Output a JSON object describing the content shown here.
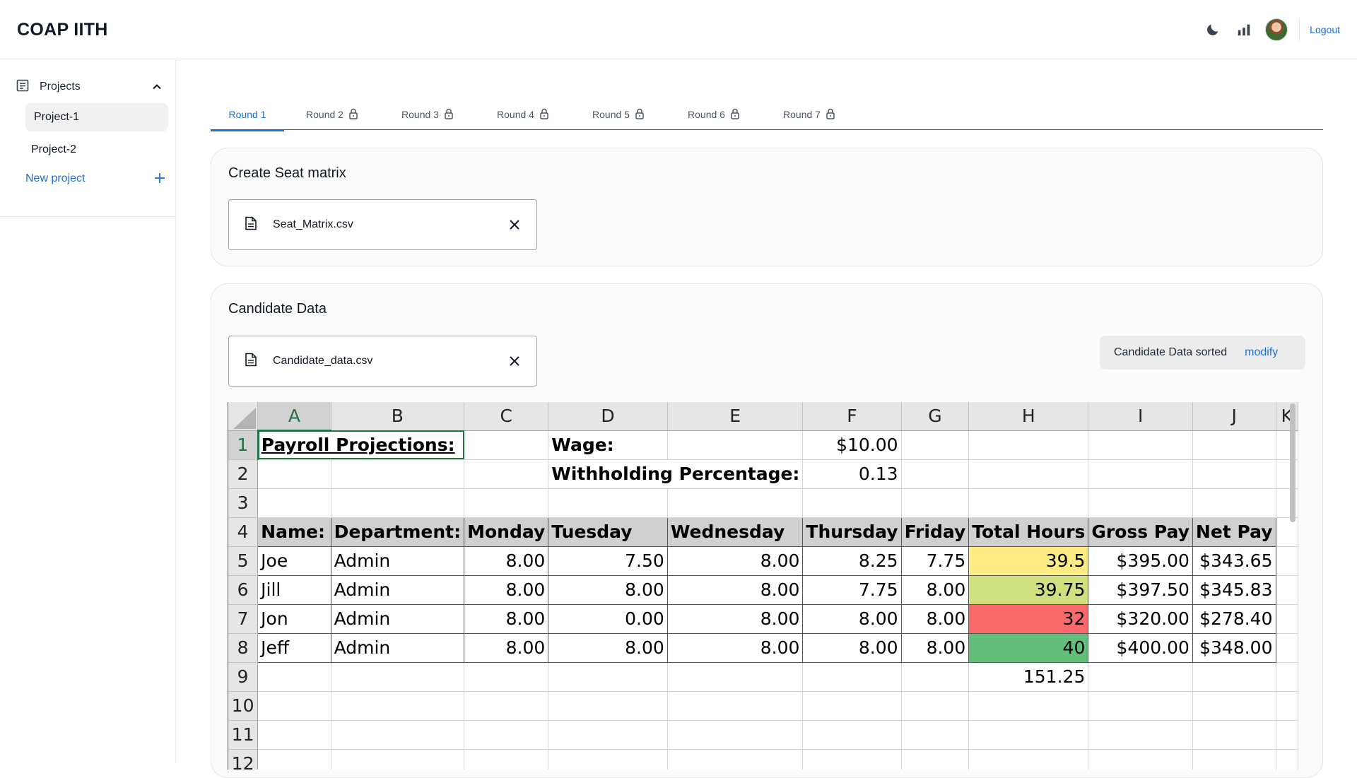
{
  "header": {
    "app_title": "COAP IITH",
    "logout_label": "Logout",
    "icons": [
      "moon-icon",
      "bar-chart-icon",
      "avatar"
    ]
  },
  "sidebar": {
    "section_label": "Projects",
    "items": [
      {
        "label": "Project-1",
        "active": true
      },
      {
        "label": "Project-2",
        "active": false
      }
    ],
    "new_project_label": "New project"
  },
  "tabs": [
    {
      "label": "Round 1",
      "locked": false,
      "active": true
    },
    {
      "label": "Round 2",
      "locked": true
    },
    {
      "label": "Round 3",
      "locked": true
    },
    {
      "label": "Round 4",
      "locked": true
    },
    {
      "label": "Round 5",
      "locked": true
    },
    {
      "label": "Round 6",
      "locked": true
    },
    {
      "label": "Round 7",
      "locked": true
    }
  ],
  "seat_matrix": {
    "title": "Create Seat matrix",
    "file_name": "Seat_Matrix.csv"
  },
  "candidate_data": {
    "title": "Candidate Data",
    "file_name": "Candidate_data.csv",
    "status_text": "Candidate Data sorted",
    "modify_label": "modify"
  },
  "spreadsheet": {
    "columns": [
      "A",
      "B",
      "C",
      "D",
      "E",
      "F",
      "G",
      "H",
      "I",
      "J",
      "K"
    ],
    "row_numbers": [
      "1",
      "2",
      "3",
      "4",
      "5",
      "6",
      "7",
      "8",
      "9",
      "10",
      "11",
      "12"
    ],
    "title": "Payroll Projections:",
    "wage_label": "Wage:",
    "wage_value": "$10.00",
    "withholding_label": "Withholding Percentage:",
    "withholding_value": "0.13",
    "table_headers": [
      "Name:",
      "Department:",
      "Monday",
      "Tuesday",
      "Wednesday",
      "Thursday",
      "Friday",
      "Total Hours",
      "Gross Pay",
      "Net Pay"
    ],
    "rows": [
      [
        "Joe",
        "Admin",
        "8.00",
        "7.50",
        "8.00",
        "8.25",
        "7.75",
        "39.5",
        "$395.00",
        "$343.65"
      ],
      [
        "Jill",
        "Admin",
        "8.00",
        "8.00",
        "8.00",
        "7.75",
        "8.00",
        "39.75",
        "$397.50",
        "$345.83"
      ],
      [
        "Jon",
        "Admin",
        "8.00",
        "0.00",
        "8.00",
        "8.00",
        "8.00",
        "32",
        "$320.00",
        "$278.40"
      ],
      [
        "Jeff",
        "Admin",
        "8.00",
        "8.00",
        "8.00",
        "8.00",
        "8.00",
        "40",
        "$400.00",
        "$348.00"
      ]
    ],
    "total_hours_sum": "151.25",
    "highlight_colors": [
      "#ffeb84",
      "#cfe17f",
      "#f8696b",
      "#63be7b"
    ]
  },
  "colors": {
    "accent": "#1d6fdc",
    "excel_green": "#217346"
  }
}
